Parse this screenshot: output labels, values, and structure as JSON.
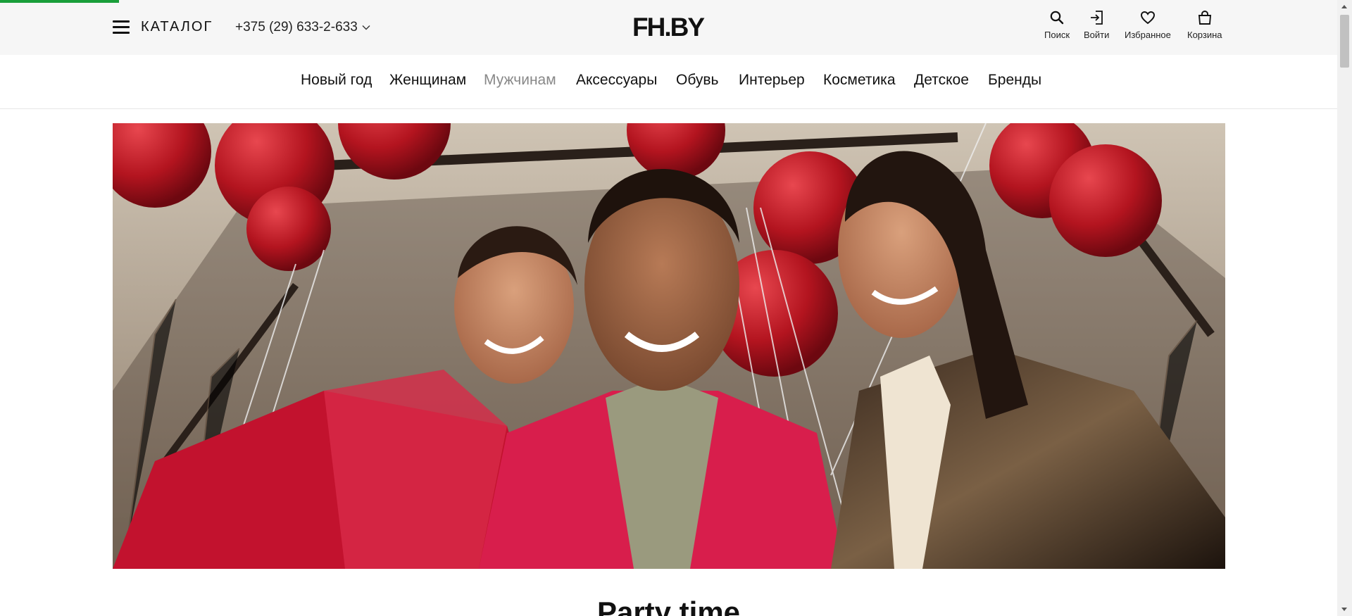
{
  "header": {
    "catalog_label": "КАТАЛОГ",
    "phone": "+375 (29) 633-2-633",
    "logo": "FH.BY",
    "actions": {
      "search": "Поиск",
      "login": "Войти",
      "favorites": "Избранное",
      "cart": "Корзина"
    }
  },
  "nav": {
    "items": [
      "Новый год",
      "Женщинам",
      "Мужчинам",
      "Аксессуары",
      "Обувь",
      "Интерьер",
      "Косметика",
      "Детское",
      "Бренды"
    ]
  },
  "main": {
    "section_title": "Party time"
  },
  "colors": {
    "progress": "#1a9e3a",
    "topbar_bg": "#f6f6f6",
    "nav_muted": "#888888"
  }
}
